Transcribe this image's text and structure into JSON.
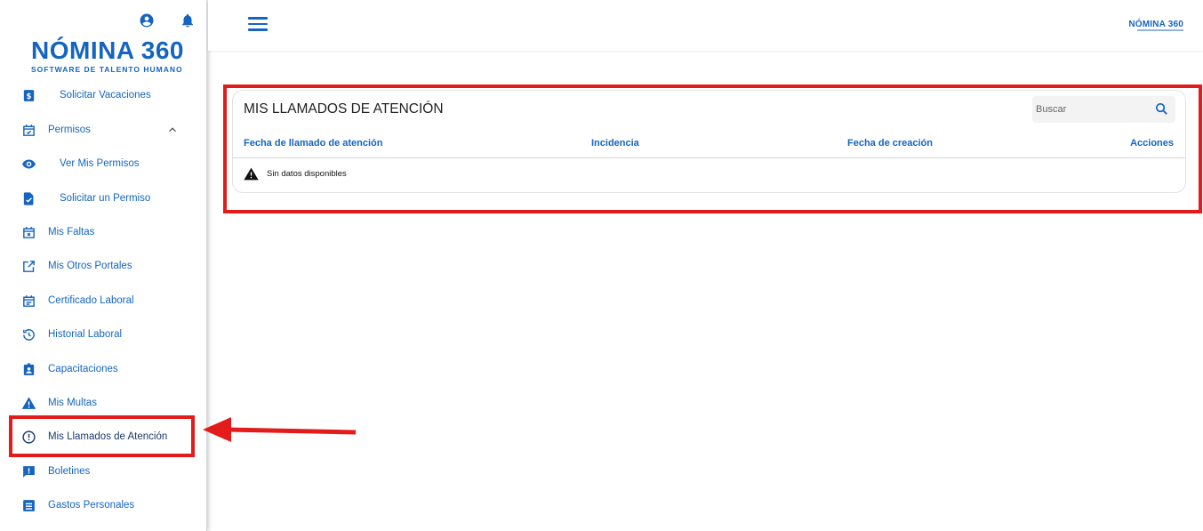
{
  "header": {
    "brand_small": "NÓMINA 360"
  },
  "logo": {
    "main": "NÓMINA 360",
    "sub": "SOFTWARE DE TALENTO HUMANO"
  },
  "sidebar": {
    "items": [
      {
        "label": "Solicitar Vacaciones",
        "icon": "dollar-doc-icon"
      },
      {
        "label": "Permisos",
        "icon": "calendar-check-icon"
      },
      {
        "label": "Ver Mis Permisos",
        "icon": "eye-icon"
      },
      {
        "label": "Solicitar un Permiso",
        "icon": "file-check-icon"
      },
      {
        "label": "Mis Faltas",
        "icon": "calendar-x-icon"
      },
      {
        "label": "Mis Otros Portales",
        "icon": "external-link-icon"
      },
      {
        "label": "Certificado Laboral",
        "icon": "calendar-text-icon"
      },
      {
        "label": "Historial Laboral",
        "icon": "history-icon"
      },
      {
        "label": "Capacitaciones",
        "icon": "badge-icon"
      },
      {
        "label": "Mis Multas",
        "icon": "warning-icon"
      },
      {
        "label": "Mis Llamados de Atención",
        "icon": "alert-circle-icon"
      },
      {
        "label": "Boletines",
        "icon": "feedback-icon"
      },
      {
        "label": "Gastos Personales",
        "icon": "list-box-icon"
      }
    ]
  },
  "main": {
    "title": "MIS LLAMADOS DE ATENCIÓN",
    "search_placeholder": "Buscar",
    "columns": [
      "Fecha de llamado de atención",
      "Incidencia",
      "Fecha de creación",
      "Acciones"
    ],
    "empty_text": "Sin datos disponibles"
  },
  "colors": {
    "primary": "#1565c0",
    "highlight": "#e31b1b"
  }
}
